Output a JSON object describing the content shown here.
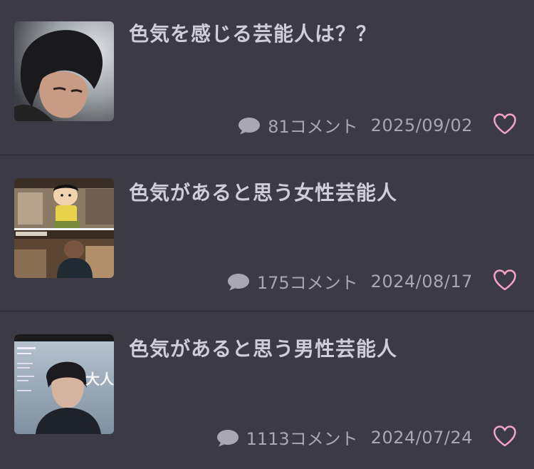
{
  "posts": [
    {
      "title": "色気を感じる芸能人は？？",
      "comments": "81コメント",
      "date": "2025/09/02",
      "thumb_icon": "photo-thumbnail"
    },
    {
      "title": "色気があると思う女性芸能人",
      "comments": "175コメント",
      "date": "2024/08/17",
      "thumb_icon": "photo-thumbnail"
    },
    {
      "title": "色気があると思う男性芸能人",
      "comments": "1113コメント",
      "date": "2024/07/24",
      "thumb_icon": "photo-thumbnail",
      "thumb_text": "大人の男"
    }
  ],
  "colors": {
    "background": "#3b3a45",
    "title": "#cfcdd6",
    "meta": "#a9a7b1",
    "heart": "#f3a6c4"
  }
}
